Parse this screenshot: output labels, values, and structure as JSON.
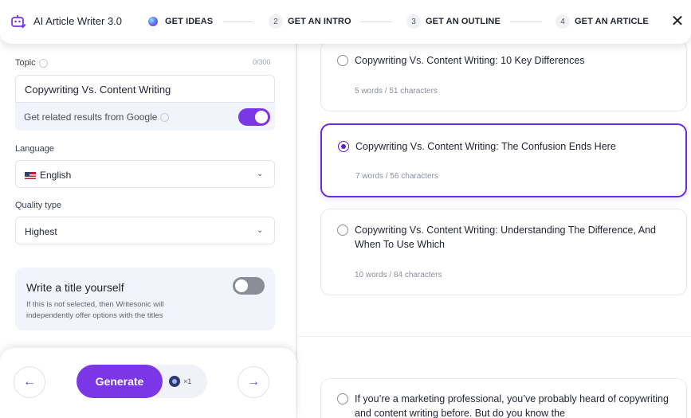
{
  "header": {
    "app_title": "AI Article Writer 3.0",
    "steps": [
      {
        "number": "",
        "label": "GET IDEAS"
      },
      {
        "number": "2",
        "label": "GET AN INTRO"
      },
      {
        "number": "3",
        "label": "GET AN OUTLINE"
      },
      {
        "number": "4",
        "label": "GET AN ARTICLE"
      }
    ],
    "close_icon": "close-icon"
  },
  "form": {
    "topic_label": "Topic",
    "topic_char_count": "0/300",
    "topic_value": "Copywriting Vs. Content Writing",
    "google_toggle_label": "Get related results from Google",
    "google_toggle_on": true,
    "language_label": "Language",
    "language_value": "English",
    "quality_label": "Quality type",
    "quality_value": "Highest",
    "title_yourself": {
      "title": "Write a title yourself",
      "description": "If this is not selected, then Writesonic will independently offer options with the titles",
      "toggle_on": false
    }
  },
  "actions": {
    "generate_label": "Generate",
    "credit_count": "×1"
  },
  "results": [
    {
      "title": "Copywriting Vs. Content Writing: 10 Key Differences",
      "meta": "5 words / 51 characters",
      "selected": false
    },
    {
      "title": "Copywriting Vs. Content Writing: The Confusion Ends Here",
      "meta": "7 words / 56 characters",
      "selected": true
    },
    {
      "title": "Copywriting Vs. Content Writing: Understanding The Difference, And When To Use Which",
      "meta": "10 words / 84 characters",
      "selected": false
    },
    {
      "title": "If you’re a marketing professional, you’ve probably heard of copywriting and content writing before. But do you know the",
      "meta": "",
      "selected": false
    }
  ],
  "colors": {
    "accent": "#7b36e8",
    "selected_border": "#6a2bd9"
  }
}
